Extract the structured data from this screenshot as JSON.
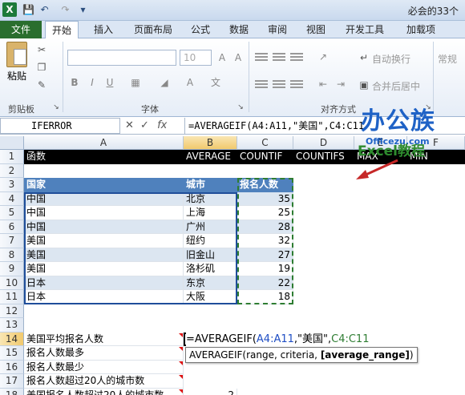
{
  "titlebar": {
    "app_icon": "X",
    "title": "必会的33个"
  },
  "qat": {
    "icons": [
      "save-icon",
      "undo-icon",
      "redo-icon",
      "customize-icon"
    ]
  },
  "tabs": {
    "file": "文件",
    "items": [
      "开始",
      "插入",
      "页面布局",
      "公式",
      "数据",
      "审阅",
      "视图",
      "开发工具",
      "加载项"
    ]
  },
  "ribbon": {
    "paste_label": "粘贴",
    "clipboard_group": "剪贴板",
    "font_group": "字体",
    "align_group": "对齐方式",
    "font_size": "10",
    "wrap_text": "自动换行",
    "merge_center": "合并后居中",
    "number_format": "常规"
  },
  "formula_bar": {
    "name_box": "IFERROR",
    "fx": "fx",
    "formula": "=AVERAGEIF(A4:A11,\"美国\",C4:C11"
  },
  "sheet": {
    "columns": [
      "A",
      "B",
      "C",
      "D",
      "E",
      "F"
    ],
    "rows": [
      "1",
      "2",
      "3",
      "4",
      "5",
      "6",
      "7",
      "8",
      "9",
      "10",
      "11",
      "12",
      "13",
      "14",
      "15",
      "16",
      "17",
      "18"
    ],
    "row1": [
      "函数",
      "AVERAGE",
      "COUNTIF",
      "COUNTIFS",
      "MAX",
      "MIN"
    ],
    "table_header": [
      "国家",
      "城市",
      "报名人数"
    ],
    "table": [
      [
        "中国",
        "北京",
        "35"
      ],
      [
        "中国",
        "上海",
        "25"
      ],
      [
        "中国",
        "广州",
        "28"
      ],
      [
        "美国",
        "纽约",
        "32"
      ],
      [
        "美国",
        "旧金山",
        "27"
      ],
      [
        "美国",
        "洛杉矶",
        "19"
      ],
      [
        "日本",
        "东京",
        "22"
      ],
      [
        "日本",
        "大阪",
        "18"
      ]
    ],
    "labels": [
      "美国平均报名人数",
      "报名人数最多",
      "报名人数最少",
      "报名人数超过20人的城市数",
      "美国报名人数超过20人的城市数"
    ],
    "b18": "2",
    "editing": {
      "prefix": "=AVERAGEIF(",
      "ref1": "A4:A11",
      "mid": ",\"美国\",",
      "ref2": "C4:C11"
    },
    "tooltip": {
      "text": "AVERAGEIF(range, criteria, ",
      "bold": "[average_range]",
      "end": ")"
    }
  },
  "watermark": {
    "main": "办公族",
    "sub": "Officezu.com",
    "excel": "Excel教程"
  },
  "colors": {
    "file_tab": "#2a6e2e",
    "table_header": "#4f81bd",
    "band": "#dce6f1",
    "ref_blue": "#1f4ec4",
    "ref_green": "#2e7d32"
  }
}
